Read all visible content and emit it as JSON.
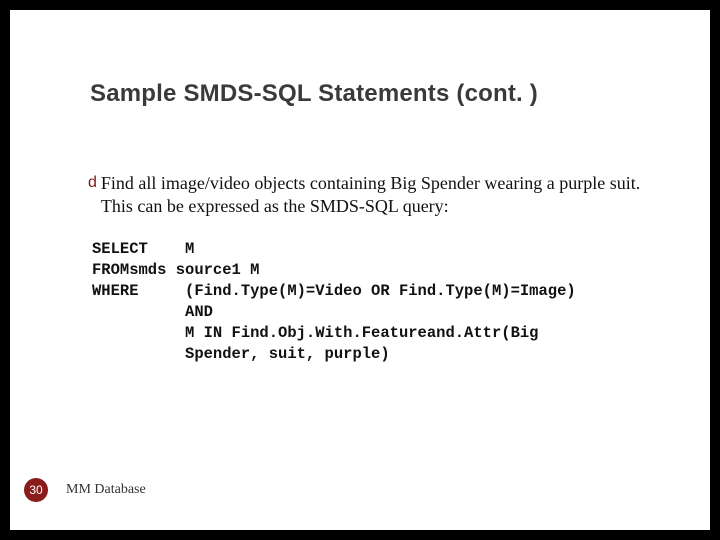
{
  "title": "Sample SMDS-SQL Statements (cont. )",
  "bullet_glyph": "d",
  "bullet_text": "Find all image/video objects containing Big Spender wearing a purple suit. This can be expressed as the SMDS-SQL query:",
  "code": "SELECT    M\nFROMsmds source1 M\nWHERE     (Find.Type(M)=Video OR Find.Type(M)=Image)\n          AND\n          M IN Find.Obj.With.Featureand.Attr(Big\n          Spender, suit, purple)",
  "footer": {
    "page": "30",
    "label": "MM Database"
  }
}
